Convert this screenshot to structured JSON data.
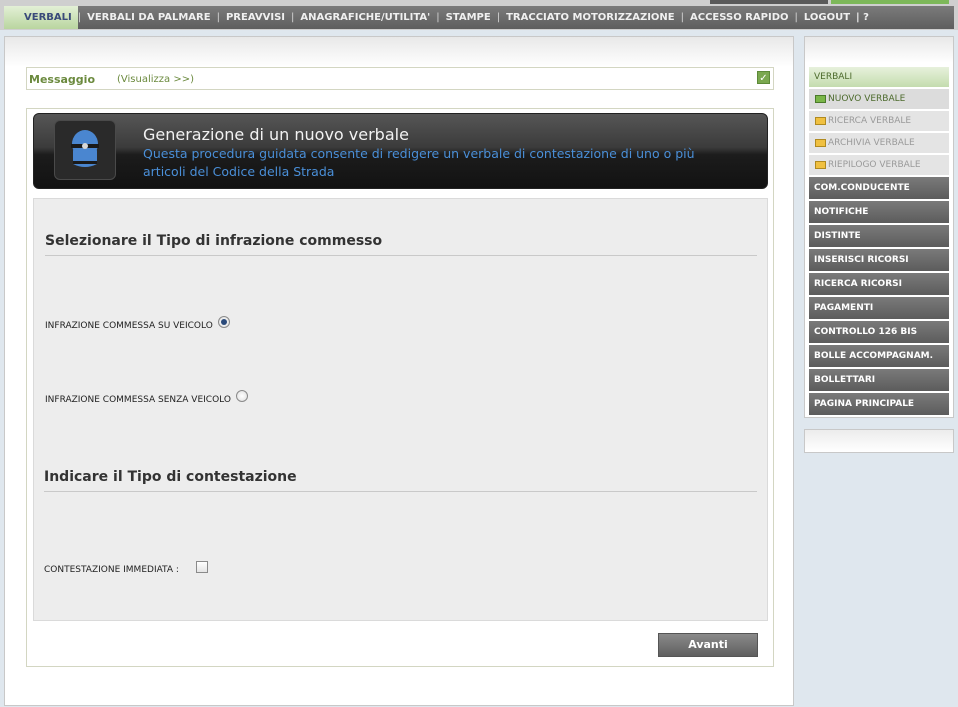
{
  "menu": {
    "items": [
      {
        "label": "VERBALI",
        "active": true
      },
      {
        "label": "VERBALI DA PALMARE"
      },
      {
        "label": "PREAVVISI"
      },
      {
        "label": "ANAGRAFICHE/UTILITA'"
      },
      {
        "label": "STAMPE"
      },
      {
        "label": "TRACCIATO MOTORIZZAZIONE"
      },
      {
        "label": "ACCESSO RAPIDO"
      },
      {
        "label": "LOGOUT"
      }
    ],
    "tail": "| ?"
  },
  "message": {
    "title": "Messaggio",
    "link": "(Visualizza >>)"
  },
  "banner": {
    "title": "Generazione di un nuovo verbale",
    "description": "Questa procedura guidata consente di redigere un verbale di contestazione di uno o più articoli del Codice della Strada",
    "icon": "police-helmet-icon"
  },
  "form": {
    "section1_title": "Selezionare il Tipo di infrazione commesso",
    "option_vehicle": "INFRAZIONE COMMESSA SU VEICOLO",
    "option_no_vehicle": "INFRAZIONE COMMESSA SENZA VEICOLO",
    "selected": "vehicle",
    "section2_title": "Indicare il Tipo di contestazione",
    "immediate_label": "CONTESTAZIONE IMMEDIATA :",
    "immediate_checked": false,
    "next_label": "Avanti"
  },
  "sidebar": {
    "header": "VERBALI",
    "sub_items": [
      {
        "label": "NUOVO VERBALE",
        "active": true
      },
      {
        "label": "RICERCA VERBALE"
      },
      {
        "label": "ARCHIVIA VERBALE"
      },
      {
        "label": "RIEPILOGO VERBALE"
      }
    ],
    "buttons": [
      "COM.CONDUCENTE",
      "NOTIFICHE",
      "DISTINTE",
      "INSERISCI RICORSI",
      "RICERCA RICORSI",
      "PAGAMENTI",
      "CONTROLLO 126 BIS",
      "BOLLE ACCOMPAGNAM.",
      "BOLLETTARI",
      "PAGINA PRINCIPALE"
    ]
  },
  "colors": {
    "accent_green": "#7db85a",
    "menu_gray": "#666666",
    "banner_text_blue": "#4a8fd8"
  }
}
